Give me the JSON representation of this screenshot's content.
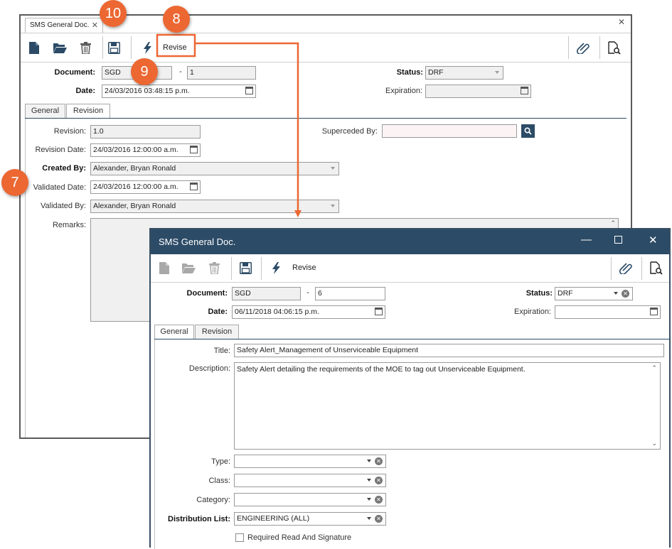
{
  "back_window": {
    "tab_title": "SMS General Doc.",
    "toolbar": {
      "revise_label": "Revise"
    },
    "document_label": "Document:",
    "document_prefix": "SGD",
    "document_dash": "-",
    "document_number": "1",
    "date_label": "Date:",
    "date_value": "24/03/2016 03:48:15 p.m.",
    "status_label": "Status:",
    "status_value": "DRF",
    "expiration_label": "Expiration:",
    "tabs": [
      {
        "label": "General"
      },
      {
        "label": "Revision"
      }
    ],
    "revision_tab": {
      "revision_label": "Revision:",
      "revision_value": "1.0",
      "superceded_label": "Superceded By:",
      "revision_date_label": "Revision Date:",
      "revision_date_value": "24/03/2016 12:00:00 a.m.",
      "created_by_label": "Created By:",
      "created_by_value": "Alexander, Bryan Ronald",
      "validated_date_label": "Validated Date:",
      "validated_date_value": "24/03/2016 12:00:00 a.m.",
      "validated_by_label": "Validated By:",
      "validated_by_value": "Alexander, Bryan Ronald",
      "remarks_label": "Remarks:"
    }
  },
  "front_window": {
    "title": "SMS General Doc.",
    "toolbar": {
      "revise_label": "Revise"
    },
    "document_label": "Document:",
    "document_prefix": "SGD",
    "document_dash": "-",
    "document_number": "6",
    "date_label": "Date:",
    "date_value": "06/11/2018 04:06:15 p.m.",
    "status_label": "Status:",
    "status_value": "DRF",
    "expiration_label": "Expiration:",
    "tabs": [
      {
        "label": "General"
      },
      {
        "label": "Revision"
      }
    ],
    "general_tab": {
      "title_label": "Title:",
      "title_value": "Safety Alert_Management of Unserviceable Equipment",
      "description_label": "Description:",
      "description_value": "Safety Alert detailing the requirements of the MOE to tag out Unserviceable Equipment.",
      "type_label": "Type:",
      "class_label": "Class:",
      "category_label": "Category:",
      "distribution_label": "Distribution List:",
      "distribution_value": "ENGINEERING (ALL)",
      "required_read_label": "Required Read And Signature"
    }
  },
  "annotations": {
    "badge_7": "7",
    "badge_8": "8",
    "badge_9": "9",
    "badge_10": "10"
  },
  "colors": {
    "accent": "#2c4b66",
    "annotation": "#ec6732",
    "search_button": "#2c4b66"
  },
  "icons": [
    "new-document-icon",
    "open-folder-icon",
    "delete-icon",
    "save-icon",
    "lightning-icon",
    "paperclip-icon",
    "document-search-icon",
    "search-icon",
    "calendar-icon",
    "chevron-down-icon",
    "clear-icon",
    "minimize-icon",
    "maximize-icon",
    "close-icon"
  ]
}
